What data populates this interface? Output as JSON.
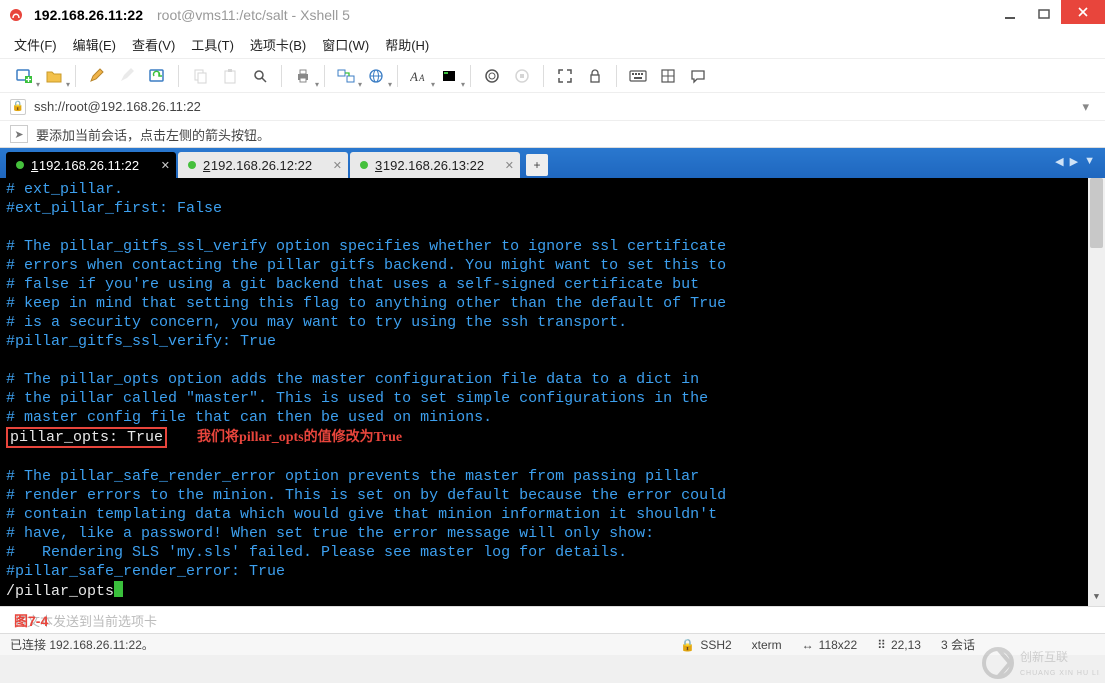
{
  "window": {
    "session_ip": "192.168.26.11:22",
    "path_title": "root@vms11:/etc/salt - Xshell 5"
  },
  "menu": {
    "file": "文件(F)",
    "edit": "编辑(E)",
    "view": "查看(V)",
    "tools": "工具(T)",
    "tabs": "选项卡(B)",
    "window": "窗口(W)",
    "help": "帮助(H)"
  },
  "toolbar_icons": {
    "new_session": "new-session-icon",
    "open": "open-folder-icon",
    "pencil": "edit-icon",
    "wand": "highlight-icon",
    "reconnect": "reconnect-icon",
    "copy": "copy-icon",
    "paste": "paste-icon",
    "find": "find-icon",
    "print": "print-icon",
    "transfer": "transfer-icon",
    "globe": "globe-icon",
    "font": "font-icon",
    "color": "color-scheme-icon",
    "script": "script-icon",
    "fullscreen": "fullscreen-icon",
    "lock": "lock-icon",
    "keyboard": "keyboard-icon",
    "layout": "layout-icon",
    "chat": "chat-icon"
  },
  "addressbar": {
    "url": "ssh://root@192.168.26.11:22"
  },
  "hintbar": {
    "text": "要添加当前会话，点击左侧的箭头按钮。"
  },
  "tabs": [
    {
      "num": "1",
      "label": "192.168.26.11:22",
      "active": true
    },
    {
      "num": "2",
      "label": "192.168.26.12:22",
      "active": false
    },
    {
      "num": "3",
      "label": "192.168.26.13:22",
      "active": false
    }
  ],
  "terminal": {
    "l0": "# ext_pillar.",
    "l1": "#ext_pillar_first: False",
    "l2": "",
    "l3": "# The pillar_gitfs_ssl_verify option specifies whether to ignore ssl certificate",
    "l4": "# errors when contacting the pillar gitfs backend. You might want to set this to",
    "l5": "# false if you're using a git backend that uses a self-signed certificate but",
    "l6": "# keep in mind that setting this flag to anything other than the default of True",
    "l7": "# is a security concern, you may want to try using the ssh transport.",
    "l8": "#pillar_gitfs_ssl_verify: True",
    "l9": "",
    "l10": "# The pillar_opts option adds the master configuration file data to a dict in",
    "l11": "# the pillar called \"master\". This is used to set simple configurations in the",
    "l12": "# master config file that can then be used on minions.",
    "highlight": "pillar_opts: True",
    "annotation": "我们将pillar_opts的值修改为True",
    "l14": "",
    "l15": "# The pillar_safe_render_error option prevents the master from passing pillar",
    "l16": "# render errors to the minion. This is set on by default because the error could",
    "l17": "# contain templating data which would give that minion information it shouldn't",
    "l18": "# have, like a password! When set true the error message will only show:",
    "l19": "#   Rendering SLS 'my.sls' failed. Please see master log for details.",
    "l20": "#pillar_safe_render_error: True",
    "l21": "/pillar_opts"
  },
  "sendbar": {
    "placeholder": "将文本发送到当前选项卡",
    "figure_label": "图7-4"
  },
  "status": {
    "connected": "已连接 192.168.26.11:22。",
    "proto": "SSH2",
    "term": "xterm",
    "size": "118x22",
    "pos": "22,13",
    "sessions": "3 会话"
  },
  "colors": {
    "comment": "#3da0ef",
    "red": "#e8453c"
  }
}
